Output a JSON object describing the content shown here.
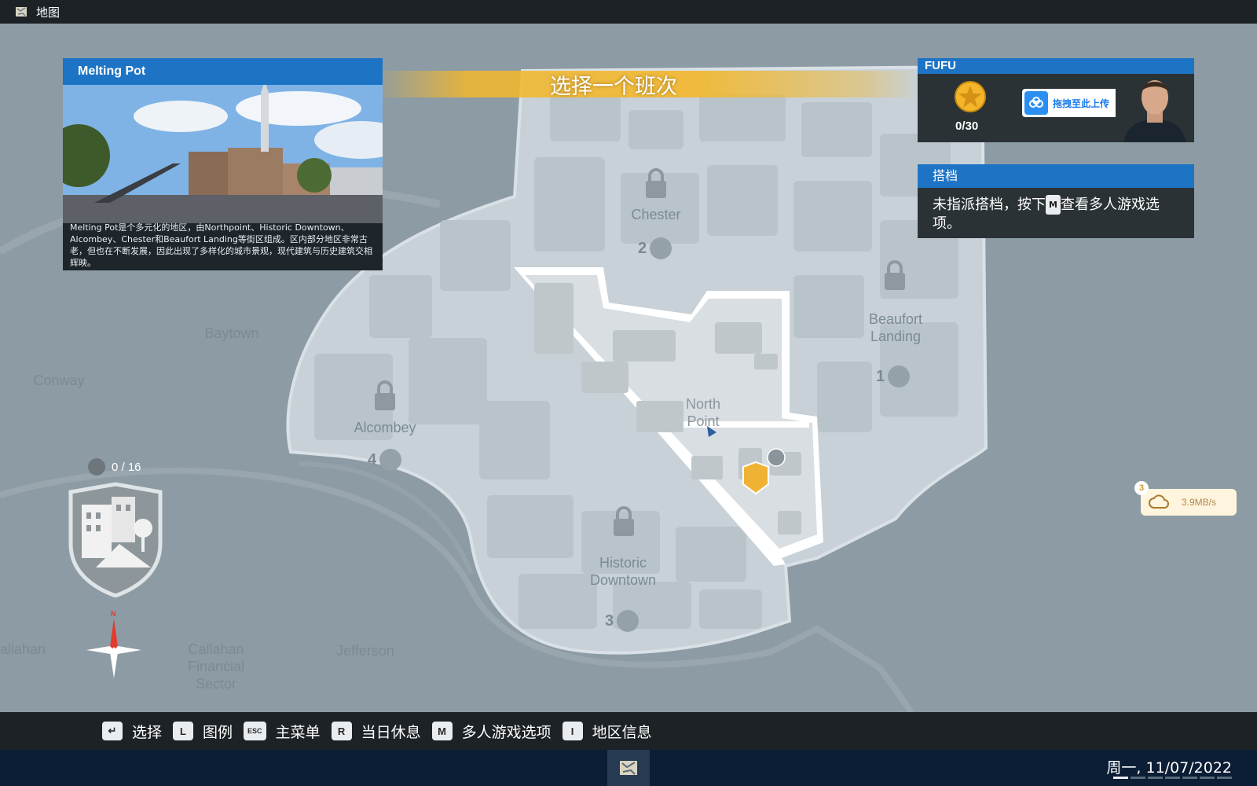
{
  "window": {
    "title": "地图"
  },
  "banner": {
    "text": "选择一个班次"
  },
  "district_card": {
    "name": "Melting Pot",
    "description": "Melting Pot是个多元化的地区，由Northpoint、Historic Downtown、Alcombey、Chester和Beaufort Landing等街区组成。区内部分地区非常古老，但也在不断发展，因此出现了多样化的城市景观，现代建筑与历史建筑交相辉映。"
  },
  "player": {
    "name": "FUFU",
    "score": "0/30",
    "upload_label": "拖拽至此上传"
  },
  "partner": {
    "title": "搭档",
    "message_before": "未指派搭档，按下",
    "key": "M",
    "message_after": "查看多人游戏选项。"
  },
  "map": {
    "labels": {
      "chester": "Chester",
      "beaufort": "Beaufort\nLanding",
      "baytown": "Baytown",
      "conway": "Conway",
      "alcombey": "Alcombey",
      "north_point": "North\nPoint",
      "historic_downtown": "Historic\nDowntown",
      "callahan": "allahan",
      "callahan_financial": "Callahan\nFinancial\nSector",
      "jefferson": "Jefferson"
    },
    "badges": {
      "chester": "2",
      "beaufort": "1",
      "alcombey": "4",
      "historic": "3"
    },
    "stars_collected": "0 / 16"
  },
  "network": {
    "count": "3",
    "speed": "3.9MB/s"
  },
  "controls": [
    {
      "key": "↵",
      "label": "选择"
    },
    {
      "key": "L",
      "label": "图例"
    },
    {
      "key": "ESC",
      "label": "主菜单"
    },
    {
      "key": "R",
      "label": "当日休息"
    },
    {
      "key": "M",
      "label": "多人游戏选项"
    },
    {
      "key": "I",
      "label": "地区信息"
    }
  ],
  "taskbar": {
    "datetime": "周一, 11/07/2022"
  },
  "colors": {
    "accent_blue": "#1e74c4",
    "banner_gold": "#f4b82c",
    "bar_dark": "#1d2226",
    "taskbar": "#0b1e35"
  }
}
